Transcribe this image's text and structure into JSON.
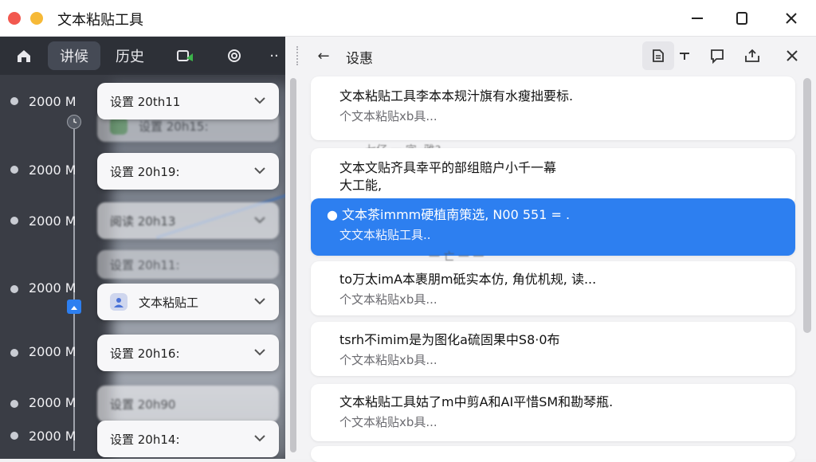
{
  "window": {
    "title": "文本粘贴工具"
  },
  "left_nav": {
    "home_icon": "home-icon",
    "tab_active": "讲候",
    "tab_history": "历史",
    "more": "··"
  },
  "timeline": [
    {
      "time": "2000 M",
      "card": "设置 20th11"
    },
    {
      "time": "2000 M",
      "card": "设置 20h19:"
    },
    {
      "time": "2000 M",
      "card": "阅读 20h13"
    },
    {
      "time": "2000 M",
      "card": "文本粘贴工"
    },
    {
      "time": "2000 M",
      "card": "设置 20h16:"
    },
    {
      "time": "2000 M",
      "card": "设置 20h90"
    },
    {
      "time": "2000 M",
      "card": "设置 20h14:"
    }
  ],
  "ghost_cards": [
    "设置 20h15:",
    "设置 20h11:"
  ],
  "right_header": {
    "back": "←",
    "title": "设惠"
  },
  "entries": [
    {
      "title": "文本粘贴工具李本本规汁旗有水瘦拙要标.",
      "sub": "个文本粘贴xb具..."
    },
    {
      "title": "文本文贴齐具幸平的部组賠户小千一幕\n大工能,",
      "sub": ""
    },
    {
      "title": "● 文本茶immm硬植南策选, N00 551 = .",
      "sub": "文文本粘贴工具.."
    },
    {
      "title": "to万太imA本裹朋m砥实本仿, 角优机规, 读...",
      "sub": "个文本粘贴xb具..."
    },
    {
      "title": "tsrh不imim是为图化a硫固果中S8·0布",
      "sub": "个文本粘贴xb具..."
    },
    {
      "title": "文本粘贴工具姑了m中剪A和AI平惜SM和勘琴瓶.",
      "sub": "个文本粘贴xb具..."
    }
  ],
  "ghost_texts": [
    "七仔 一 字, 雅?",
    "一 亡 一 一"
  ]
}
